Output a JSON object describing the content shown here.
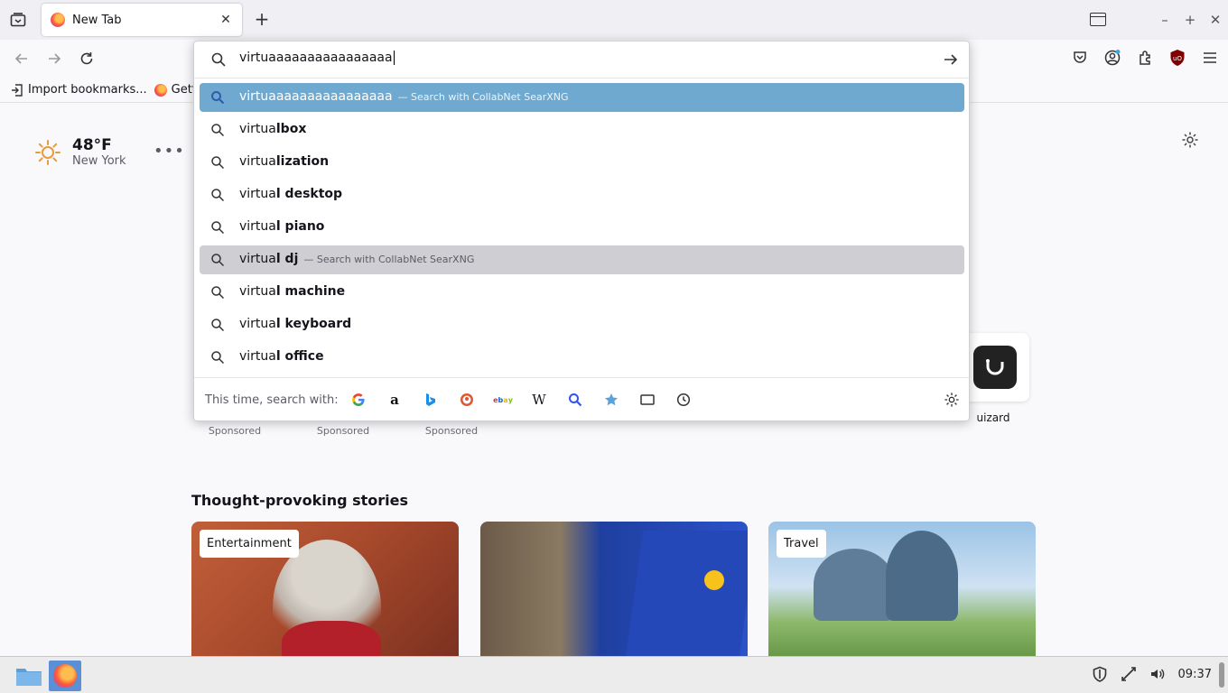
{
  "tabs": [
    {
      "title": "New Tab"
    }
  ],
  "toolbar": {
    "url_value": "virtuaaaaaaaaaaaaaaaa"
  },
  "bookmarks": [
    {
      "label": "Import bookmarks..."
    },
    {
      "label": "Gett"
    }
  ],
  "weather": {
    "temp": "48°F",
    "city": "New York"
  },
  "urlbar_results": [
    {
      "prefix": "virtuaaaaaaaaaaaaaaaa",
      "bold": "",
      "action": "— Search with CollabNet SearXNG"
    },
    {
      "prefix": "virtua",
      "bold": "lbox",
      "action": ""
    },
    {
      "prefix": "virtua",
      "bold": "lization",
      "action": ""
    },
    {
      "prefix": "virtua",
      "bold": "l desktop",
      "action": ""
    },
    {
      "prefix": "virtua",
      "bold": "l piano",
      "action": ""
    },
    {
      "prefix": "virtua",
      "bold": "l dj",
      "action": "— Search with CollabNet SearXNG"
    },
    {
      "prefix": "virtua",
      "bold": "l machine",
      "action": ""
    },
    {
      "prefix": "virtua",
      "bold": "l keyboard",
      "action": ""
    },
    {
      "prefix": "virtua",
      "bold": "l office",
      "action": ""
    }
  ],
  "oneoff": {
    "label": "This time, search with:"
  },
  "shortcuts": [
    {
      "label": "uizard"
    }
  ],
  "sponsored": [
    {
      "label": "Sponsored"
    },
    {
      "label": "Sponsored"
    },
    {
      "label": "Sponsored"
    }
  ],
  "stories": {
    "title": "Thought-provoking stories",
    "cards": [
      {
        "badge": "Entertainment"
      },
      {
        "badge": ""
      },
      {
        "badge": "Travel"
      }
    ]
  },
  "taskbar": {
    "clock": "09:37"
  },
  "colors": {
    "accent": "#6fa9cf",
    "hover": "#cfcfd3"
  }
}
